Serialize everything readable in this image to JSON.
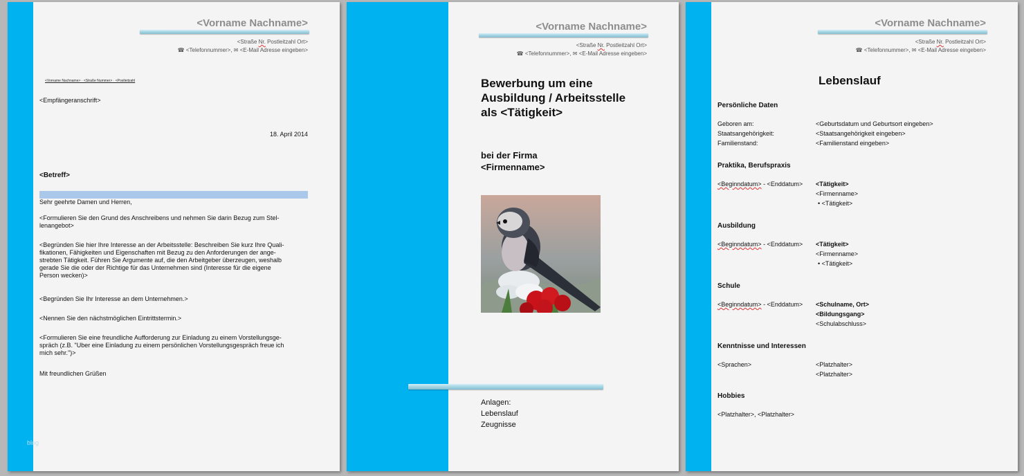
{
  "header": {
    "name": "<Vorname Nachname>",
    "street_a": "<Straße ",
    "street_nr": "Nr.",
    "street_b": " Postleitzahl  Ort>",
    "contact": "☎ <Telefonnummer>,  ✉ <E-Mail Adresse  eingeben>"
  },
  "letter": {
    "sender_line": "<Vorname  Nachname>  ·  <Straße  Nummer>  ·  <Postleitzahl",
    "recipient": "<Empfängeranschrift>",
    "date": "18. April 2014",
    "subject": "<Betreff>",
    "salutation": "Sehr geehrte Damen und Herren,",
    "para1_l1": "<Formulieren Sie den Grund des Anschreibens und nehmen Sie darin Bezug zum Stel-",
    "para1_l2": "lenangebot>",
    "para2_l1": "<Begründen Sie hier Ihre Interesse an der Arbeitsstelle: Beschreiben Sie kurz Ihre Quali-",
    "para2_l2": "fikationen, Fähigkeiten und Eigenschaften mit Bezug zu den Anforderungen der ange-",
    "para2_l3": "strebten Tätigkeit. Führen Sie Argumente auf, die den Arbeitgeber überzeugen, weshalb",
    "para2_l4": "gerade Sie die oder der Richtige für das Unternehmen sind (Interesse für die eigene",
    "para2_l5": "Person wecken)>",
    "para3": "<Begründen Sie Ihr Interesse an dem Unternehmen.>",
    "para4": "<Nennen Sie den nächstmöglichen Eintrittstermin.>",
    "para5_l1": "<Formulieren Sie eine freundliche Aufforderung zur Einladung zu einem Vorstellungsge-",
    "para5_l2": "spräch (z.B. \"Uber eine Einladung zu einem persönlichen Vorstellungsgespräch freue ich",
    "para5_l3": "mich sehr.\")>",
    "closing": "Mit freundlichen Grüßen",
    "watermark": "blog"
  },
  "cover": {
    "title_l1": "Bewerbung um eine",
    "title_l2": "Ausbildung / Arbeitsstelle",
    "title_l3": "als <Tätigkeit>",
    "company_l1": "bei der Firma",
    "company_l2": "<Firmenname>",
    "attachments_title": "Anlagen:",
    "attachment_1": "Lebenslauf",
    "attachment_2": "Zeugnisse"
  },
  "cv": {
    "title": "Lebenslauf",
    "personal_heading": "Persönliche  Daten",
    "born_label": "Geboren am:",
    "born_value": "<Geburtsdatum und Geburtsort eingeben>",
    "nationality_label": "Staatsangehörigkeit:",
    "nationality_value": "<Staatsangehörigkeit eingeben>",
    "family_label": "Familienstand:",
    "family_value": "<Familienstand eingeben>",
    "practice_heading": "Praktika,  Berufspraxis",
    "date_start": "<Beginndatum>",
    "date_sep": " - <Enddatum>",
    "job_title": "<Tätigkeit>",
    "company": "<Firmenname>",
    "task": "<Tätigkeit>",
    "education_heading": "Ausbildung",
    "school_heading": "Schule",
    "school_name": "<Schulname, Ort>",
    "school_course": "<Bildungsgang>",
    "school_degree": "<Schulabschluss>",
    "skills_heading": "Kenntnisse  und  Interessen",
    "languages": "<Sprachen>",
    "placeholder": "<Platzhalter>",
    "hobbies_heading": "Hobbies",
    "hobbies_value": "<Platzhalter>, <Platzhalter>"
  },
  "colors": {
    "stripe": "#00b2f0",
    "page": "#f4f4f4",
    "header_bar": "#a8d7e6"
  }
}
